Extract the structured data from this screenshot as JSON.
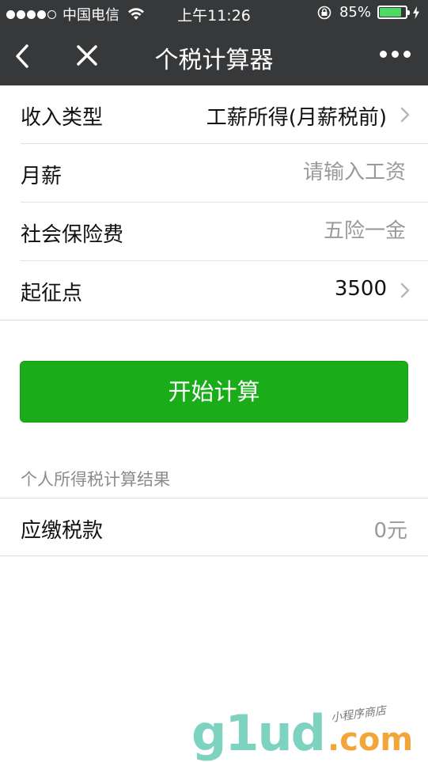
{
  "status_bar": {
    "carrier": "中国电信",
    "time": "上午11:26",
    "battery_percent": "85%",
    "battery_level": 0.85
  },
  "nav": {
    "title": "个税计算器"
  },
  "form": {
    "income_type": {
      "label": "收入类型",
      "value": "工薪所得(月薪税前)"
    },
    "salary": {
      "label": "月薪",
      "placeholder": "请输入工资"
    },
    "insurance": {
      "label": "社会保险费",
      "placeholder": "五险一金"
    },
    "threshold": {
      "label": "起征点",
      "value": "3500"
    }
  },
  "calculate_button": {
    "label": "开始计算"
  },
  "result": {
    "title": "个人所得税计算结果",
    "tax_label": "应缴税款",
    "tax_value": "0元"
  },
  "watermark": {
    "logo": "g1ud",
    "domain": ".com",
    "tagline": "小程序商店"
  },
  "colors": {
    "header_bg": "#36383a",
    "accent_green": "#1aad19",
    "battery_green": "#4cd964"
  }
}
